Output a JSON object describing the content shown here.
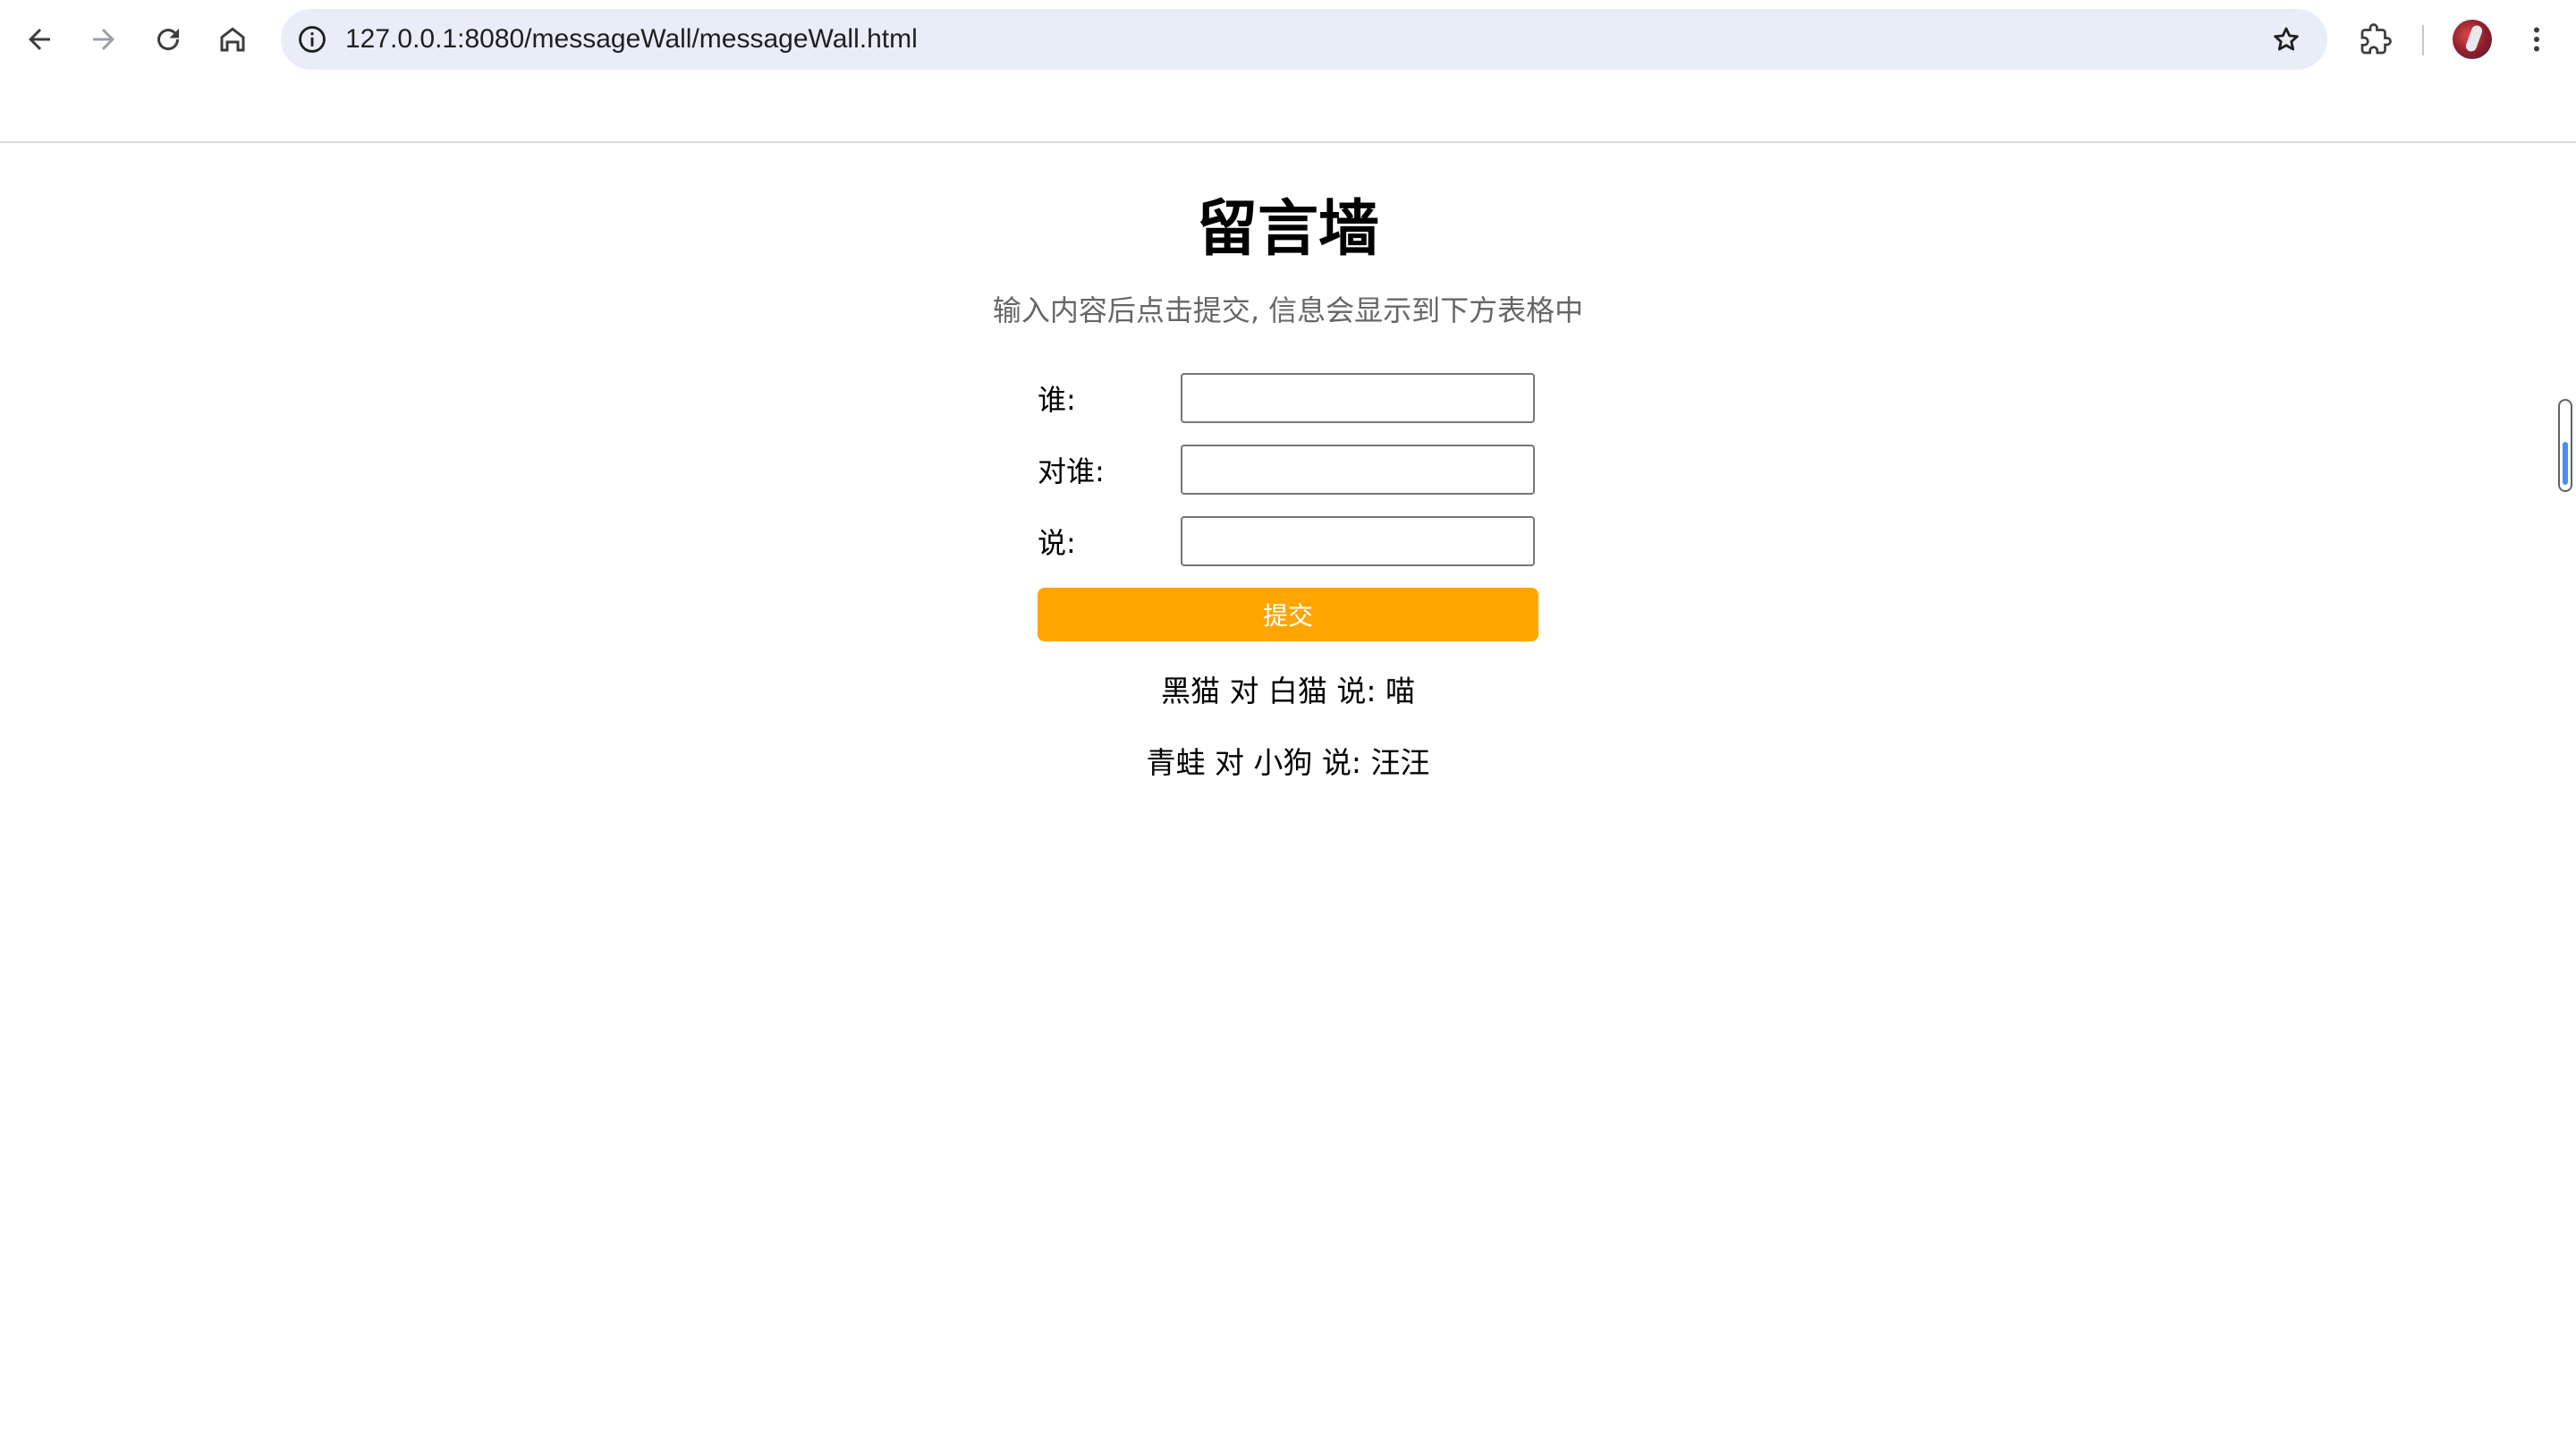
{
  "browser": {
    "url": "127.0.0.1:8080/messageWall/messageWall.html"
  },
  "page": {
    "title": "留言墙",
    "subtitle": "输入内容后点击提交, 信息会显示到下方表格中"
  },
  "form": {
    "from_label": "谁:",
    "to_label": "对谁:",
    "message_label": "说:",
    "submit_label": "提交",
    "from_value": "",
    "to_value": "",
    "message_value": ""
  },
  "messages": [
    "黑猫 对 白猫 说: 喵",
    "青蛙 对 小狗 说: 汪汪"
  ],
  "colors": {
    "submit_button": "#ffa500",
    "subtitle_text": "#666666",
    "omnibox": "#e9edf7"
  }
}
